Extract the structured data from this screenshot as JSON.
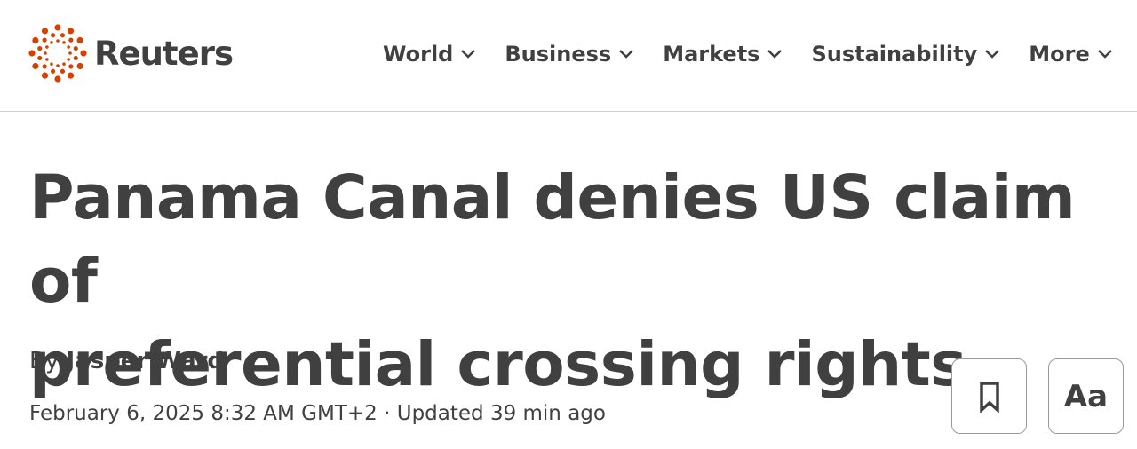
{
  "brand": {
    "name": "Reuters",
    "logo_icon": "reuters-dot-ring-logo",
    "accent_color": "#d64000"
  },
  "nav": {
    "items": [
      {
        "label": "World"
      },
      {
        "label": "Business"
      },
      {
        "label": "Markets"
      },
      {
        "label": "Sustainability"
      },
      {
        "label": "More"
      }
    ]
  },
  "article": {
    "headline_line1": "Panama Canal denies US claim of",
    "headline_line2": "preferential crossing rights",
    "byline_prefix": "By ",
    "author": "Jasper Ward",
    "dateline": "February 6, 2025 8:32 AM GMT+2 · Updated 39 min ago"
  },
  "actions": {
    "bookmark_icon": "bookmark-icon",
    "text_size_label": "Aa"
  }
}
